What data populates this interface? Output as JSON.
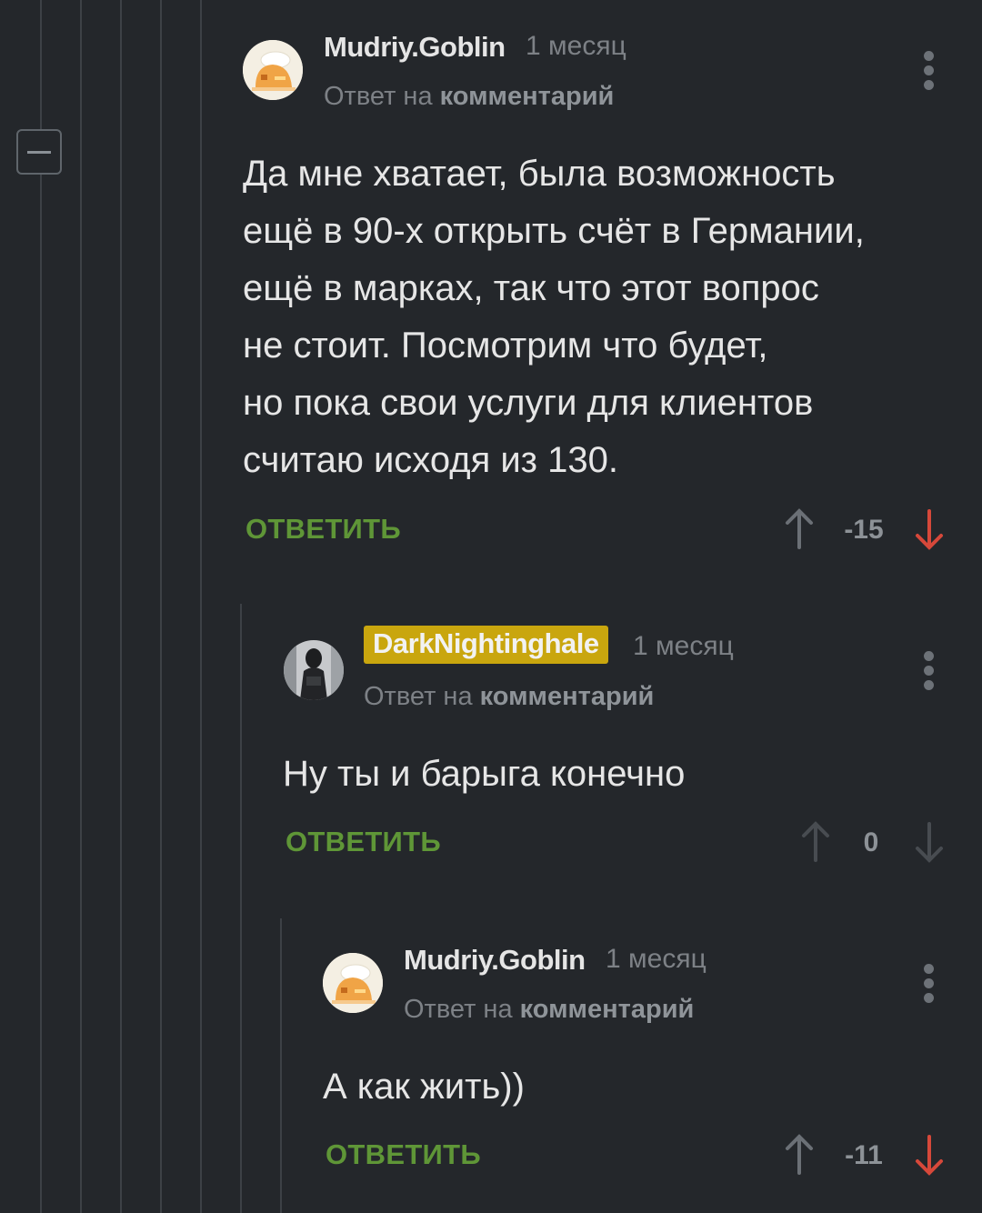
{
  "comments": [
    {
      "author": "Mudriy.Goblin",
      "time": "1 месяц",
      "reply_prefix": "Ответ на",
      "reply_target": "комментарий",
      "lines": [
        "Да мне хватает, была возможность",
        "ещё в 90-х открыть счёт в Германии,",
        "ещё  в марках, так что этот вопрос",
        "не стоит. Посмотрим что будет,",
        "но пока свои услуги для клиентов",
        "считаю исходя из 130."
      ],
      "reply_label": "ОТВЕТИТЬ",
      "score": "-15",
      "vote_state": "down"
    },
    {
      "author": "DarkNightinghale",
      "time": "1 месяц",
      "reply_prefix": "Ответ на",
      "reply_target": "комментарий",
      "lines": [
        "Ну ты и барыга конечно"
      ],
      "reply_label": "ОТВЕТИТЬ",
      "score": "0",
      "vote_state": "none"
    },
    {
      "author": "Mudriy.Goblin",
      "time": "1 месяц",
      "reply_prefix": "Ответ на",
      "reply_target": "комментарий",
      "lines": [
        "А как жить))"
      ],
      "reply_label": "ОТВЕТИТЬ",
      "score": "-11",
      "vote_state": "down"
    }
  ],
  "colors": {
    "background": "#24272b",
    "reply_green": "#5f9637",
    "downvote_red": "#d6483a",
    "author_badge": "#c9a60e",
    "muted": "#7d8186"
  },
  "icons": {
    "collapse": "minus-square-icon",
    "menu": "vertical-dots-icon",
    "upvote": "arrow-up-icon",
    "downvote": "arrow-down-icon"
  }
}
